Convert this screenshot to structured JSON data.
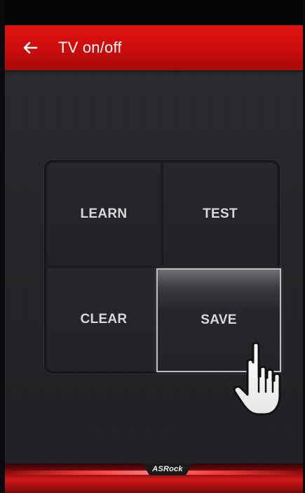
{
  "app_bar": {
    "title": "TV on/off",
    "back_icon": "arrow-left-icon"
  },
  "keypad": {
    "learn_label": "LEARN",
    "test_label": "TEST",
    "clear_label": "CLEAR",
    "save_label": "SAVE"
  },
  "cursor": {
    "icon": "hand-pointer-icon"
  },
  "footer": {
    "brand": "ASRock"
  },
  "colors": {
    "accent": "#d0191a",
    "background": "#242528",
    "button_text": "#d8d8da"
  }
}
